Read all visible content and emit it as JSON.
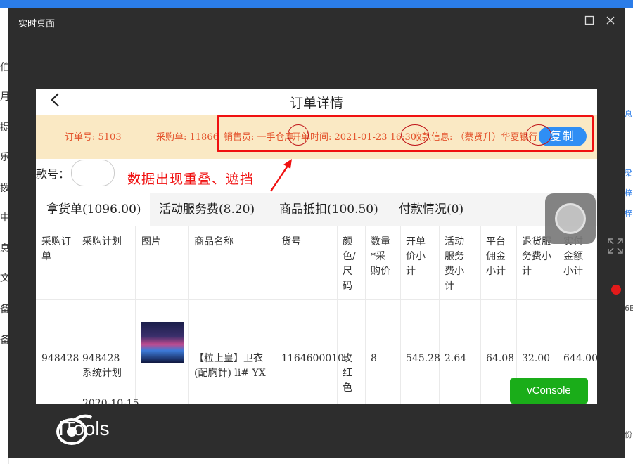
{
  "window": {
    "title": "实时桌面"
  },
  "left_edge_chars": [
    "伯",
    "月",
    "提",
    "乐",
    "拨",
    "中",
    "息",
    "文",
    "备",
    "备"
  ],
  "right_edge_chars": [
    "息",
    "梁",
    "梓",
    "梓",
    "6B",
    "份"
  ],
  "phone": {
    "page_title": "订单详情",
    "info_bar": {
      "order_no": "订单号: 5103",
      "purchase_no": "采购单: 11866",
      "seller": "销售员: 一手仓库",
      "open_time": "开单时间: 2021-01-23 16:30",
      "receive_info": "收款信息: （蔡贤升）华夏银行",
      "copy_button": "复制"
    },
    "style_no_label": "款号：",
    "annotation": "数据出现重叠、遮挡",
    "tabs": [
      {
        "label": "拿货单(1096.00)",
        "active": true
      },
      {
        "label": "活动服务费(8.20)",
        "active": false
      },
      {
        "label": "商品抵扣(100.50)",
        "active": false
      },
      {
        "label": "付款情况(0)",
        "active": false
      }
    ],
    "table": {
      "headers": [
        "采购订单",
        "采购计划",
        "图片",
        "商品名称",
        "货号",
        "颜色/尺码",
        "数量*采购价",
        "开单价小计",
        "活动服务费小计",
        "平台佣金小计",
        "退货服务费小计",
        "实付金额小计"
      ],
      "row": {
        "order": "948428",
        "plan_line1": "948428",
        "plan_line2": "系统计划",
        "plan_line3": "2020-10-15",
        "name_line1": "【粒上皇】卫衣",
        "name_line2": "(配胸针) li# YX",
        "sku": "1164600010",
        "color_l1": "玫",
        "color_l2": "红",
        "color_l3": "色",
        "qty": "8",
        "open_price": "545.28",
        "activity_fee": "2.64",
        "commission": "64.08",
        "return_fee": "32.00",
        "paid": "644.00"
      }
    },
    "vconsole": "vConsole"
  },
  "brand": "iTools",
  "colors": {
    "accent_red": "#f01010",
    "info_bar_bg": "#fae9c4",
    "copy_button_bg": "#2f8ef4",
    "vconsole_bg": "#1aad19"
  }
}
